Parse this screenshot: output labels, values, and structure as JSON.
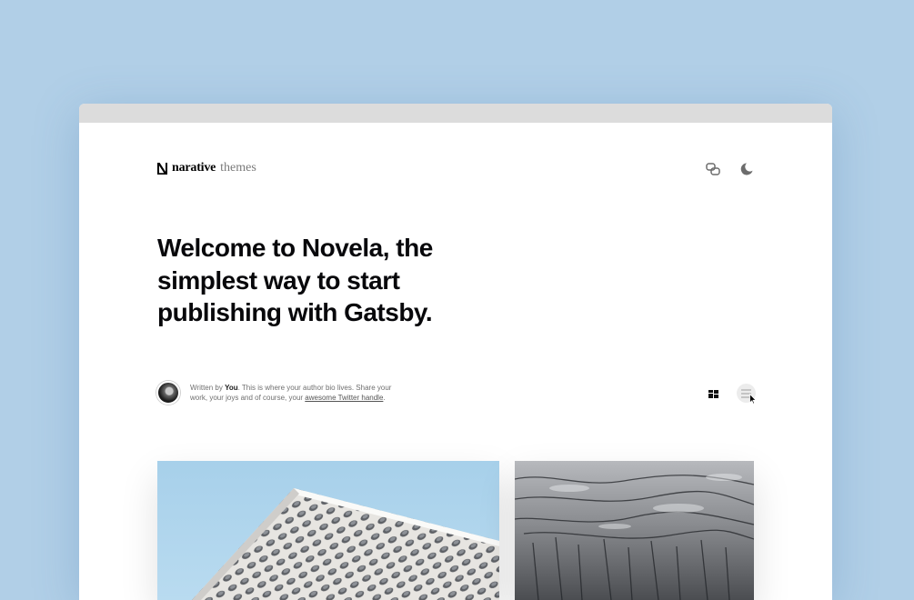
{
  "header": {
    "logo_word": "narative",
    "logo_sub": "themes"
  },
  "hero": {
    "title": "Welcome to Novela, the simplest way to start publishing with Gatsby."
  },
  "author": {
    "prefix": "Written by ",
    "name": "You",
    "bio_text": ". This is where your author bio lives. Share your work, your joys and of course, your ",
    "link_text": "awesome Twitter handle",
    "suffix": "."
  },
  "icons": {
    "copy": "copy-link-icon",
    "theme": "moon-icon",
    "grid_layout": "grid-layout-icon",
    "list_layout": "list-layout-icon",
    "cursor": "mouse-cursor-icon"
  },
  "colors": {
    "page_background": "#b1cfe7",
    "window_background": "#ffffff",
    "title_bar": "#dcdcdc",
    "heading_text": "#08080b"
  },
  "articles": [
    {
      "image": "perforated-white-building-facade-against-blue-sky"
    },
    {
      "image": "aerial-view-of-icy-rocky-terrain"
    }
  ]
}
